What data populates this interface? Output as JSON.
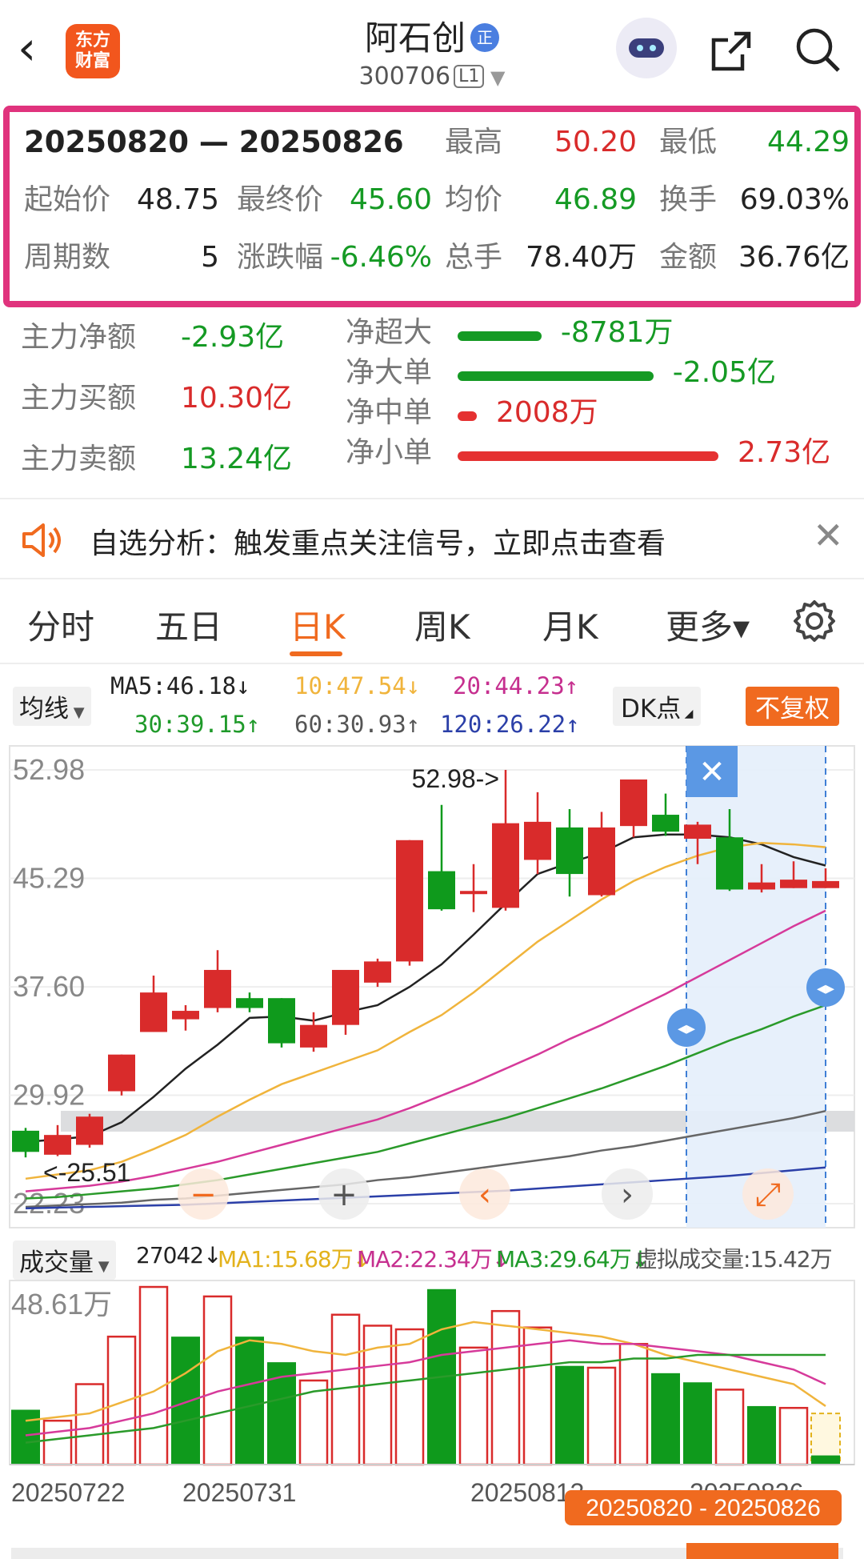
{
  "header": {
    "back_icon": "chevron-left-icon",
    "logo_text": "东方\n财富",
    "stock_name": "阿石创",
    "name_tag": "正",
    "stock_code": "300706",
    "level": "L1"
  },
  "summary": {
    "range": "20250820 — 20250826",
    "high_label": "最高",
    "high": "50.20",
    "low_label": "最低",
    "low": "44.29",
    "open_label": "起始价",
    "open": "48.75",
    "close_label": "最终价",
    "close": "45.60",
    "avg_label": "均价",
    "avg": "46.89",
    "turnover_label": "换手",
    "turnover": "69.03%",
    "periods_label": "周期数",
    "periods": "5",
    "change_label": "涨跌幅",
    "change": "-6.46%",
    "volume_label": "总手",
    "volume": "78.40万",
    "amount_label": "金额",
    "amount": "36.76亿"
  },
  "fund_flow": {
    "main_net_label": "主力净额",
    "main_net": "-2.93亿",
    "main_buy_label": "主力买额",
    "main_buy": "10.30亿",
    "main_sell_label": "主力卖额",
    "main_sell": "13.24亿",
    "rows": [
      {
        "label": "净超大",
        "value": "-8781万",
        "amount": -0.8781,
        "color": "#159a24"
      },
      {
        "label": "净大单",
        "value": "-2.05亿",
        "amount": -2.05,
        "color": "#159a24"
      },
      {
        "label": "净中单",
        "value": "2008万",
        "amount": 0.2008,
        "color": "#e53131"
      },
      {
        "label": "净小单",
        "value": "2.73亿",
        "amount": 2.73,
        "color": "#e53131"
      }
    ]
  },
  "notice": {
    "icon": "speaker-icon",
    "text": "自选分析：触发重点关注信号，立即点击查看",
    "close_icon": "close-icon"
  },
  "tabs": [
    {
      "label": "分时",
      "active": false
    },
    {
      "label": "五日",
      "active": false
    },
    {
      "label": "日K",
      "active": true
    },
    {
      "label": "周K",
      "active": false
    },
    {
      "label": "月K",
      "active": false
    },
    {
      "label": "更多▾",
      "active": false
    }
  ],
  "ma_bar": {
    "select": "均线",
    "ma5": "MA5:46.18↓",
    "ma10": "10:47.54↓",
    "ma20": "20:44.23↑",
    "ma30": "30:39.15↑",
    "ma60": "60:30.93↑",
    "ma120": "120:26.22↑",
    "dk_button": "DK点",
    "restore_button": "不复权"
  },
  "volume_bar": {
    "select": "成交量",
    "vol": "27042↓",
    "ma1": "MA1:15.68万↓",
    "ma2": "MA2:22.34万↓",
    "ma3": "MA3:29.64万↓",
    "virtual": "虚拟成交量:15.42万"
  },
  "colors": {
    "up": "#d92b2b",
    "down": "#0f9a1c",
    "accent": "#f06a1f",
    "highlight": "#e0337d",
    "ma5": "#222222",
    "ma10": "#f0b43c",
    "ma20": "#d63a9a",
    "ma30": "#2a9a2a",
    "ma60": "#666666",
    "ma120": "#2b3fa8"
  },
  "chart_data": {
    "type": "candlestick",
    "y_ticks": [
      "52.98",
      "45.29",
      "37.60",
      "29.92",
      "22.23"
    ],
    "ylim": [
      22.23,
      52.98
    ],
    "max_marker": "52.98->",
    "min_marker": "<-25.51",
    "selection_range": "20250820 - 20250826",
    "dates": [
      "20250722",
      "20250731",
      "20250813",
      "20250826"
    ],
    "candles": [
      {
        "o": 27.4,
        "h": 27.6,
        "l": 25.51,
        "c": 25.9
      },
      {
        "o": 25.7,
        "h": 27.8,
        "l": 25.6,
        "c": 27.1
      },
      {
        "o": 26.4,
        "h": 28.6,
        "l": 26.2,
        "c": 28.4
      },
      {
        "o": 30.2,
        "h": 32.8,
        "l": 29.9,
        "c": 32.8
      },
      {
        "o": 34.4,
        "h": 38.4,
        "l": 34.4,
        "c": 37.2
      },
      {
        "o": 35.3,
        "h": 36.3,
        "l": 34.5,
        "c": 35.9
      },
      {
        "o": 36.1,
        "h": 40.2,
        "l": 35.8,
        "c": 38.8
      },
      {
        "o": 36.8,
        "h": 37.2,
        "l": 35.8,
        "c": 36.1
      },
      {
        "o": 36.8,
        "h": 36.8,
        "l": 33.3,
        "c": 33.6
      },
      {
        "o": 33.3,
        "h": 35.8,
        "l": 33.0,
        "c": 34.9
      },
      {
        "o": 34.9,
        "h": 38.5,
        "l": 34.2,
        "c": 38.8
      },
      {
        "o": 37.9,
        "h": 39.6,
        "l": 37.6,
        "c": 39.4
      },
      {
        "o": 39.4,
        "h": 48.0,
        "l": 39.1,
        "c": 48.0
      },
      {
        "o": 45.8,
        "h": 50.5,
        "l": 43.0,
        "c": 43.1
      },
      {
        "o": 44.4,
        "h": 46.3,
        "l": 42.9,
        "c": 44.4
      },
      {
        "o": 43.2,
        "h": 52.98,
        "l": 43.0,
        "c": 49.2
      },
      {
        "o": 46.6,
        "h": 51.4,
        "l": 45.6,
        "c": 49.3
      },
      {
        "o": 48.9,
        "h": 50.2,
        "l": 44.0,
        "c": 45.6
      },
      {
        "o": 44.1,
        "h": 50.0,
        "l": 44.0,
        "c": 48.9
      },
      {
        "o": 49.0,
        "h": 52.3,
        "l": 48.2,
        "c": 52.3
      },
      {
        "o": 49.8,
        "h": 51.3,
        "l": 48.3,
        "c": 48.6
      },
      {
        "o": 48.1,
        "h": 49.3,
        "l": 46.3,
        "c": 49.1
      },
      {
        "o": 48.2,
        "h": 50.2,
        "l": 44.4,
        "c": 44.5
      },
      {
        "o": 44.5,
        "h": 46.3,
        "l": 44.29,
        "c": 45.0
      },
      {
        "o": 44.6,
        "h": 46.5,
        "l": 44.6,
        "c": 45.2
      },
      {
        "o": 44.6,
        "h": 46.0,
        "l": 44.6,
        "c": 45.1
      }
    ],
    "selected_from_index": 21,
    "ma_lines": {
      "ma5": [
        26.6,
        26.8,
        27.0,
        28.0,
        29.8,
        31.8,
        33.5,
        35.4,
        35.5,
        35.2,
        35.8,
        36.3,
        37.6,
        39.2,
        41.3,
        43.5,
        45.6,
        46.4,
        47.1,
        48.2,
        48.4,
        48.4,
        48.2,
        47.7,
        46.8,
        46.2
      ],
      "ma10": [
        24.0,
        24.3,
        24.6,
        25.2,
        26.1,
        27.1,
        28.4,
        29.6,
        30.7,
        31.5,
        32.3,
        33.1,
        34.4,
        35.6,
        37.2,
        39.0,
        40.8,
        42.3,
        43.8,
        45.1,
        46.1,
        46.9,
        47.5,
        47.8,
        47.7,
        47.5
      ],
      "ma20": [
        23.1,
        23.3,
        23.5,
        23.8,
        24.2,
        24.7,
        25.2,
        25.8,
        26.4,
        27.0,
        27.6,
        28.2,
        29.0,
        29.9,
        30.8,
        31.8,
        32.8,
        33.9,
        34.9,
        36.0,
        37.1,
        38.3,
        39.5,
        40.7,
        41.9,
        43.0
      ],
      "ma30": [
        22.6,
        22.7,
        22.9,
        23.1,
        23.3,
        23.6,
        23.9,
        24.3,
        24.7,
        25.1,
        25.5,
        25.9,
        26.5,
        27.1,
        27.7,
        28.3,
        29.0,
        29.7,
        30.4,
        31.2,
        32.0,
        32.9,
        33.8,
        34.6,
        35.5,
        36.3
      ],
      "ma60": [
        22.0,
        22.1,
        22.2,
        22.3,
        22.5,
        22.6,
        22.8,
        23.0,
        23.2,
        23.4,
        23.6,
        23.9,
        24.1,
        24.4,
        24.7,
        25.0,
        25.3,
        25.6,
        26.0,
        26.3,
        26.7,
        27.1,
        27.5,
        27.9,
        28.3,
        28.8
      ],
      "ma120": [
        21.9,
        21.95,
        22.0,
        22.05,
        22.1,
        22.15,
        22.25,
        22.35,
        22.45,
        22.55,
        22.65,
        22.75,
        22.85,
        22.95,
        23.05,
        23.15,
        23.3,
        23.45,
        23.6,
        23.75,
        23.9,
        24.05,
        24.2,
        24.4,
        24.6,
        24.8
      ]
    },
    "volume": {
      "max_label": "48.61万",
      "ymax": 48.61,
      "values": [
        15.0,
        12.0,
        22.0,
        35.0,
        48.6,
        35.0,
        46.0,
        35.0,
        28.0,
        23.0,
        41.0,
        38.0,
        37.0,
        48.0,
        32.0,
        42.0,
        37.5,
        27.0,
        26.5,
        33.0,
        25.0,
        22.5,
        20.5,
        16.0,
        15.5,
        2.5
      ],
      "up": [
        false,
        true,
        true,
        true,
        true,
        false,
        true,
        false,
        false,
        true,
        true,
        true,
        true,
        false,
        true,
        true,
        true,
        false,
        true,
        true,
        false,
        false,
        true,
        false,
        true,
        false
      ],
      "ma1": [
        12,
        13,
        14,
        17,
        20,
        25,
        31,
        34,
        33,
        31,
        30,
        32,
        33,
        37,
        39,
        38,
        37,
        36,
        35,
        33,
        30,
        28,
        26,
        24,
        22,
        16
      ],
      "ma2": [
        8,
        9,
        10,
        12,
        14,
        17,
        20,
        22,
        24,
        25,
        26,
        27,
        28,
        30,
        31,
        32,
        33,
        34,
        33,
        33,
        32,
        31,
        30,
        28,
        26,
        22
      ],
      "ma3": [
        6,
        7,
        8,
        9,
        10,
        12,
        14,
        16,
        18,
        20,
        21,
        22,
        23,
        24,
        25,
        26,
        27,
        28,
        28,
        29,
        29,
        30,
        30,
        30,
        30,
        30
      ]
    }
  }
}
